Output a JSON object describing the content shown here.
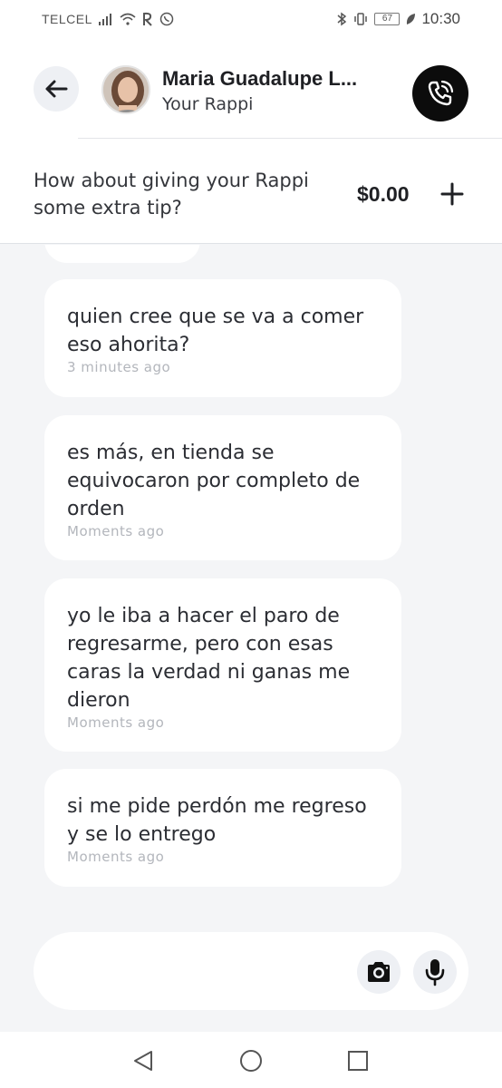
{
  "status_bar": {
    "carrier": "TELCEL",
    "battery": "67",
    "time": "10:30"
  },
  "header": {
    "contact_name": "Maria Guadalupe L...",
    "contact_role": "Your Rappi",
    "back_icon": "arrow-left-icon",
    "call_icon": "phone-call-icon"
  },
  "tip": {
    "prompt": "How about giving your Rappi some extra tip?",
    "amount": "$0.00",
    "add_icon": "plus-icon"
  },
  "messages": [
    {
      "text": "quien cree que se va a comer eso ahorita?",
      "time": "3 minutes ago"
    },
    {
      "text": "es más, en tienda se equivocaron por completo de orden",
      "time": "Moments ago"
    },
    {
      "text": "yo le iba a hacer el paro de regresarme, pero con esas caras la verdad ni ganas me dieron",
      "time": "Moments ago"
    },
    {
      "text": "si me pide perdón me regreso y se lo entrego",
      "time": "Moments ago"
    }
  ],
  "composer": {
    "input_value": "",
    "placeholder": "",
    "camera_icon": "camera-icon",
    "mic_icon": "microphone-icon"
  },
  "nav_bar": {
    "back_icon": "triangle-back-icon",
    "home_icon": "circle-home-icon",
    "recent_icon": "square-recent-icon"
  },
  "colors": {
    "background": "#f4f5f7",
    "bubble": "#ffffff",
    "call_button": "#0c0c0c",
    "timestamp": "#b3b6bc"
  }
}
